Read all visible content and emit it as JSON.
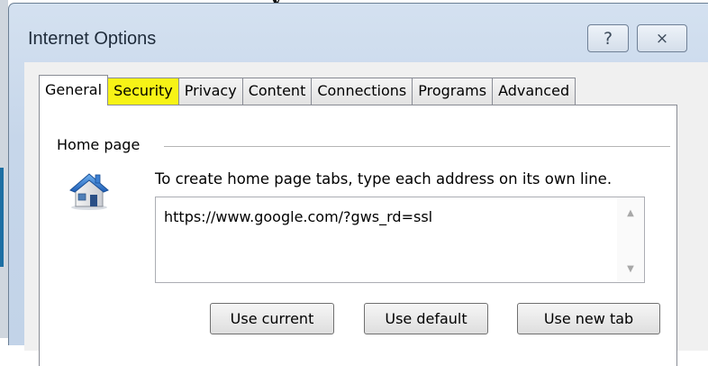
{
  "page": {
    "cropped_top_text": "y"
  },
  "window": {
    "title": "Internet Options",
    "help_glyph": "?",
    "close_glyph": "⨯"
  },
  "tabs": [
    {
      "label": "General",
      "active": true
    },
    {
      "label": "Security",
      "highlighted": true
    },
    {
      "label": "Privacy"
    },
    {
      "label": "Content"
    },
    {
      "label": "Connections"
    },
    {
      "label": "Programs"
    },
    {
      "label": "Advanced"
    }
  ],
  "home_page": {
    "group_label": "Home page",
    "icon": "house-icon",
    "instructions": "To create home page tabs, type each address on its own line.",
    "url_value": "https://www.google.com/?gws_rd=ssl",
    "buttons": {
      "use_current": "Use current",
      "use_default": "Use default",
      "use_new_tab": "Use new tab"
    }
  },
  "colors": {
    "highlight": "#f7f316",
    "titlebar": "#c6d6ea",
    "panel": "#ffffff"
  }
}
